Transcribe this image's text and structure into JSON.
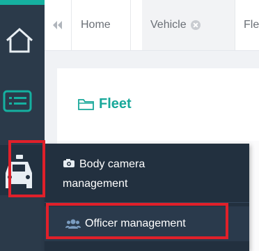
{
  "colors": {
    "rail_bg": "#2b3a4a",
    "accent": "#15b0a0",
    "highlight": "#e0202a",
    "flyout_bg": "#22303f"
  },
  "rail": {
    "icons": [
      "home-icon",
      "list-icon",
      "police-car-icon"
    ]
  },
  "tabs": {
    "back_icon": "double-chevron-left-icon",
    "items": [
      {
        "label": "Home"
      },
      {
        "label": "Vehicle"
      },
      {
        "label": "Fle"
      }
    ]
  },
  "panel": {
    "title": "Fleet",
    "title_icon": "folder-icon"
  },
  "flyout": {
    "items": [
      {
        "label_line1": "Body camera",
        "label_line2": "management",
        "icon": "camera-icon"
      },
      {
        "label": "Officer management",
        "icon": "users-icon"
      }
    ]
  }
}
